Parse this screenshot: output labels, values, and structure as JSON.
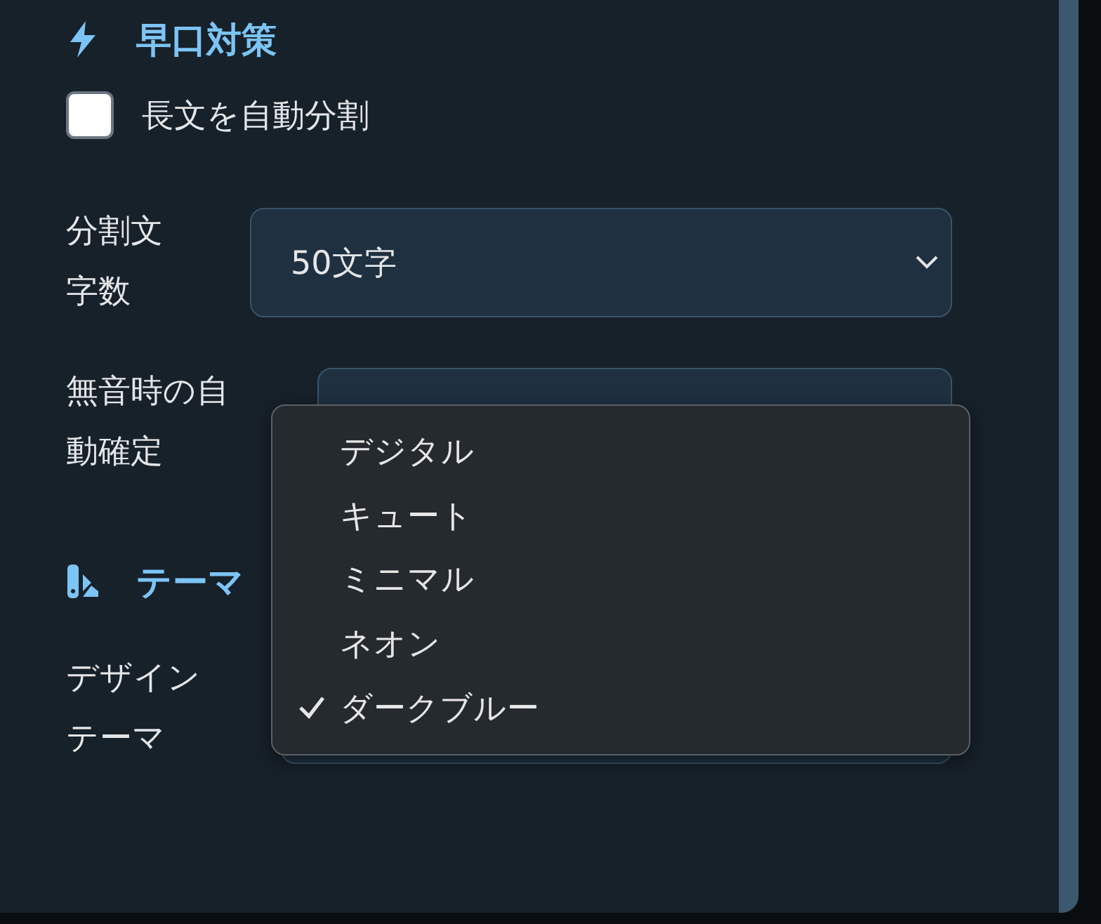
{
  "sections": [
    {
      "title": "早口対策",
      "fields": [
        {
          "kind": "checkbox",
          "label": "長文を自動分割",
          "checked": false
        },
        {
          "kind": "select",
          "label": "分割文字数",
          "value": "50文字"
        },
        {
          "kind": "select",
          "label": "無音時の自動確定"
        }
      ]
    },
    {
      "title": "テーマ",
      "fields": [
        {
          "kind": "select",
          "label": "デザインテーマ"
        }
      ]
    }
  ],
  "menu": {
    "options": [
      {
        "label": "デジタル",
        "selected": false
      },
      {
        "label": "キュート",
        "selected": false
      },
      {
        "label": "ミニマル",
        "selected": false
      },
      {
        "label": "ネオン",
        "selected": false
      },
      {
        "label": "ダークブルー",
        "selected": true
      }
    ]
  }
}
